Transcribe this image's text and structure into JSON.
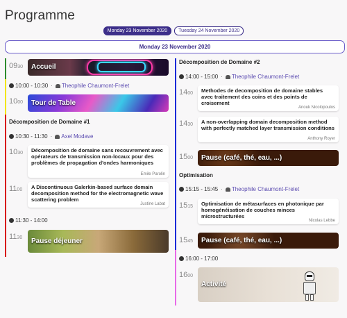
{
  "page": {
    "title": "Programme"
  },
  "days": [
    {
      "label": "Monday 23 November 2020",
      "active": true
    },
    {
      "label": "Tuesday 24 November 2020",
      "active": false
    }
  ],
  "day_header": "Monday 23 November 2020",
  "left": {
    "accueil": {
      "time_h": "09",
      "time_m": "30",
      "label": "Accueil"
    },
    "slot1": {
      "time": "10:00 - 10:30",
      "speaker": "Theophile Chaumont-Frelet"
    },
    "tour": {
      "time_h": "10",
      "time_m": "00",
      "label": "Tour de Table"
    },
    "session1": {
      "title": "Décomposition de Domaine #1",
      "time": "10:30 - 11:30",
      "speaker": "Axel Modave"
    },
    "talk1": {
      "time_h": "10",
      "time_m": "30",
      "title": "Décomposition de domaine sans recouvrement avec opérateurs de transmission non-locaux pour des problèmes de propagation d'ondes harmoniques",
      "speaker": "Emile Parolin"
    },
    "talk2": {
      "time_h": "11",
      "time_m": "00",
      "title": "A Discontinuous Galerkin-based surface domain decomposition method for the electromagnetic wave scattering problem",
      "speaker": "Justine Labat"
    },
    "slot2": {
      "time": "11:30 - 14:00"
    },
    "lunch": {
      "time_h": "11",
      "time_m": "30",
      "label": "Pause déjeuner"
    }
  },
  "right": {
    "session2": {
      "title": "Décomposition de Domaine #2",
      "time": "14:00 - 15:00",
      "speaker": "Theophile Chaumont-Frelet"
    },
    "talk3": {
      "time_h": "14",
      "time_m": "00",
      "title": "Methodes de decomposition de domaine stables avec traitement des coins et des points de croisement",
      "speaker": "Anouk Nicolopoulos"
    },
    "talk4": {
      "time_h": "14",
      "time_m": "30",
      "title": "A non-overlapping domain decomposition method with perfectly matched layer transmission conditions",
      "speaker": "Anthony Royer"
    },
    "pause1": {
      "time_h": "15",
      "time_m": "00",
      "label": "Pause (café, thé, eau, ...)"
    },
    "session3": {
      "title": "Optimisation",
      "time": "15:15 - 15:45",
      "speaker": "Theophile Chaumont-Frelet"
    },
    "talk5": {
      "time_h": "15",
      "time_m": "15",
      "title": "Optimisation de métasurfaces en photonique par homogénéisation de couches minces microstructurées",
      "speaker": "Nicolas Lebbe"
    },
    "pause2": {
      "time_h": "15",
      "time_m": "45",
      "label": "Pause (café, thé, eau, ...)"
    },
    "slot3": {
      "time": "16:00 - 17:00"
    },
    "activite": {
      "time_h": "16",
      "time_m": "00",
      "label": "Activité"
    }
  },
  "colors": {
    "accent": "#3d2f8a",
    "green": "#2e8b2e",
    "yellow": "#f2e600",
    "red": "#d81a1a",
    "blue": "#1a2ad8",
    "pink": "#e86ae8"
  }
}
